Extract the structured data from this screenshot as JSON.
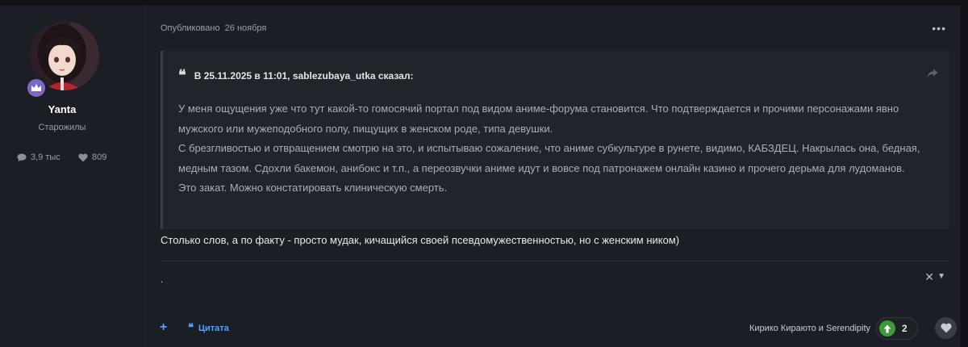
{
  "author": {
    "name": "Yanta",
    "group": "Старожилы",
    "posts_count": "3,9 тыс",
    "reputation": "809",
    "badge_icon": "crown-icon"
  },
  "post": {
    "posted_label": "Опубликовано",
    "posted_date": "26 ноября",
    "more_label": "•••",
    "quote": {
      "header": "В 25.11.2025 в 11:01, sablezubaya_utka сказал:",
      "paragraphs": [
        "У меня ощущения уже что тут какой-то гомосячий портал под видом аниме-форума становится. Что подтверждается и прочими персонажами явно мужского или мужеподобного полу, пищущих в женском роде, типа девушки.",
        "С брезгливостью и отвращением смотрю на это, и испытываю сожаление, что аниме субкультуре в рунете, видимо, КАБЗДЕЦ. Накрылась она, бедная, медным тазом. Сдохли бакемон, анибокс и т.п., а переозвучки аниме идут и вовсе под патронажем онлайн казино и прочего дерьма для лудоманов.",
        "Это закат. Можно констатировать клиническую смерть."
      ]
    },
    "reply_text": "Столько слов, а по факту - просто мудак, кичащийся своей псевдомужественностью, но с женским ником)",
    "signature_text": "."
  },
  "footer": {
    "plus_label": "+",
    "cite_label": "Цитата",
    "reactors_text": "Кирико Кираюто и Serendipity",
    "reaction_count": "2"
  },
  "colors": {
    "accent": "#4aa3ff",
    "badge": "#7b68c9",
    "upvote": "#3c9a3a"
  }
}
